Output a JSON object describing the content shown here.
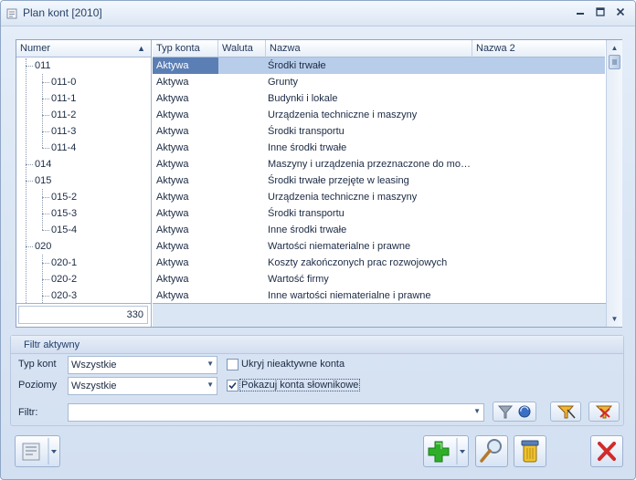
{
  "window": {
    "title": "Plan kont [2010]"
  },
  "tree": {
    "header": "Numer",
    "items": [
      {
        "label": "011",
        "level": 0
      },
      {
        "label": "011-0",
        "level": 1
      },
      {
        "label": "011-1",
        "level": 1
      },
      {
        "label": "011-2",
        "level": 1
      },
      {
        "label": "011-3",
        "level": 1
      },
      {
        "label": "011-4",
        "level": 1
      },
      {
        "label": "014",
        "level": 0
      },
      {
        "label": "015",
        "level": 0
      },
      {
        "label": "015-2",
        "level": 1
      },
      {
        "label": "015-3",
        "level": 1
      },
      {
        "label": "015-4",
        "level": 1
      },
      {
        "label": "020",
        "level": 0
      },
      {
        "label": "020-1",
        "level": 1
      },
      {
        "label": "020-2",
        "level": 1
      },
      {
        "label": "020-3",
        "level": 1
      }
    ],
    "count": "330"
  },
  "table": {
    "columns": [
      "Typ konta",
      "Waluta",
      "Nazwa",
      "Nazwa 2"
    ],
    "rows": [
      {
        "typ": "Aktywa",
        "nazwa": "Środki trwałe"
      },
      {
        "typ": "Aktywa",
        "nazwa": "Grunty"
      },
      {
        "typ": "Aktywa",
        "nazwa": "Budynki i lokale"
      },
      {
        "typ": "Aktywa",
        "nazwa": "Urządzenia techniczne i maszyny"
      },
      {
        "typ": "Aktywa",
        "nazwa": "Środki transportu"
      },
      {
        "typ": "Aktywa",
        "nazwa": "Inne środki trwałe"
      },
      {
        "typ": "Aktywa",
        "nazwa": "Maszyny i urządzenia przeznaczone do mo…"
      },
      {
        "typ": "Aktywa",
        "nazwa": "Środki trwałe przejęte w leasing"
      },
      {
        "typ": "Aktywa",
        "nazwa": "Urządzenia techniczne i maszyny"
      },
      {
        "typ": "Aktywa",
        "nazwa": "Środki transportu"
      },
      {
        "typ": "Aktywa",
        "nazwa": "Inne środki trwałe"
      },
      {
        "typ": "Aktywa",
        "nazwa": "Wartości niematerialne i prawne"
      },
      {
        "typ": "Aktywa",
        "nazwa": "Koszty zakończonych prac rozwojowych"
      },
      {
        "typ": "Aktywa",
        "nazwa": "Wartość firmy"
      },
      {
        "typ": "Aktywa",
        "nazwa": "Inne wartości niematerialne i prawne"
      }
    ]
  },
  "filter": {
    "group_title": "Filtr aktywny",
    "typ_kont_label": "Typ kont",
    "typ_kont_value": "Wszystkie",
    "poziomy_label": "Poziomy",
    "poziomy_value": "Wszystkie",
    "hide_inactive_label": "Ukryj nieaktywne konta",
    "hide_inactive_checked": false,
    "show_dict_label": "Pokazuj konta słownikowe",
    "show_dict_checked": true,
    "filtr_label": "Filtr:",
    "filtr_value": ""
  },
  "colors": {
    "selection": "#b8cdea",
    "selection_cell": "#5b7fb5",
    "add_green": "#2fae2a",
    "close_red": "#d22a2a"
  }
}
